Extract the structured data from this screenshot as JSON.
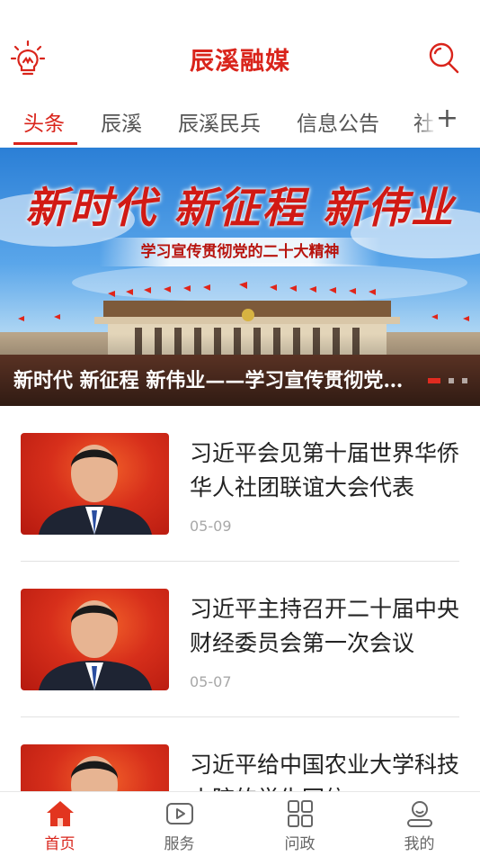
{
  "header": {
    "title": "辰溪融媒",
    "left_icon": "lightbulb-icon",
    "right_icon": "search-icon",
    "accent_color": "#d9241b"
  },
  "tabs": {
    "items": [
      "头条",
      "辰溪",
      "辰溪民兵",
      "信息公告",
      "社"
    ],
    "active_index": 0,
    "add_icon": "+"
  },
  "banner": {
    "headline": "新时代 新征程 新伟业",
    "subtitle": "学习宣传贯彻党的二十大精神",
    "caption": "新时代 新征程 新伟业——学习宣传贯彻党的二十大精神",
    "slide_count": 3,
    "active_slide": 0
  },
  "news": [
    {
      "title": "习近平会见第十届世界华侨华人社团联谊大会代表",
      "date": "05-09"
    },
    {
      "title": "习近平主持召开二十届中央财经委员会第一次会议",
      "date": "05-07"
    },
    {
      "title": "习近平给中国农业大学科技小院的学生回信",
      "date": ""
    }
  ],
  "bottom_nav": {
    "items": [
      {
        "label": "首页",
        "icon": "home-icon"
      },
      {
        "label": "服务",
        "icon": "play-icon"
      },
      {
        "label": "问政",
        "icon": "grid-icon"
      },
      {
        "label": "我的",
        "icon": "user-icon"
      }
    ],
    "active_index": 0
  }
}
